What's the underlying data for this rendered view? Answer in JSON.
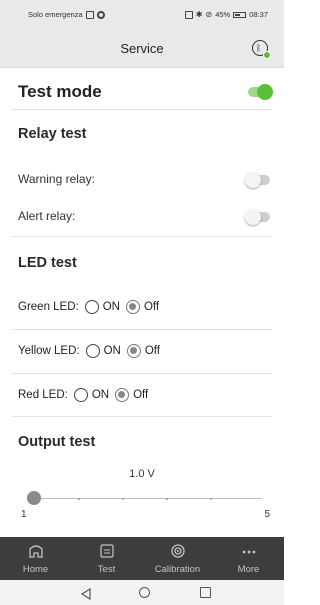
{
  "statusbar": {
    "carrier": "Solo emergenza",
    "battery": "45%",
    "time": "08:37"
  },
  "appbar": {
    "title": "Service",
    "bluetooth_icon": "bluetooth-connected-icon"
  },
  "test_mode": {
    "label": "Test mode",
    "enabled": true
  },
  "relay_test": {
    "heading": "Relay test",
    "warning_label": "Warning relay:",
    "warning_on": false,
    "alert_label": "Alert relay:",
    "alert_on": false
  },
  "led_test": {
    "heading": "LED test",
    "on_label": "ON",
    "off_label": "Off",
    "leds": [
      {
        "label": "Green LED:",
        "selected": "Off"
      },
      {
        "label": "Yellow LED:",
        "selected": "Off"
      },
      {
        "label": "Red LED:",
        "selected": "Off"
      }
    ]
  },
  "output_test": {
    "heading": "Output test",
    "value_label": "1.0 V",
    "min": "1",
    "max": "5",
    "value": 1
  },
  "colors": {
    "toggle_on": "#5bbf3a",
    "nav_bg": "#3d3d3d",
    "appbar_bg": "#e9e9e9"
  },
  "bottom_nav": [
    {
      "label": "Home",
      "icon": "home-icon"
    },
    {
      "label": "Test",
      "icon": "test-icon"
    },
    {
      "label": "Calibration",
      "icon": "calibration-icon"
    },
    {
      "label": "More",
      "icon": "more-icon"
    }
  ]
}
